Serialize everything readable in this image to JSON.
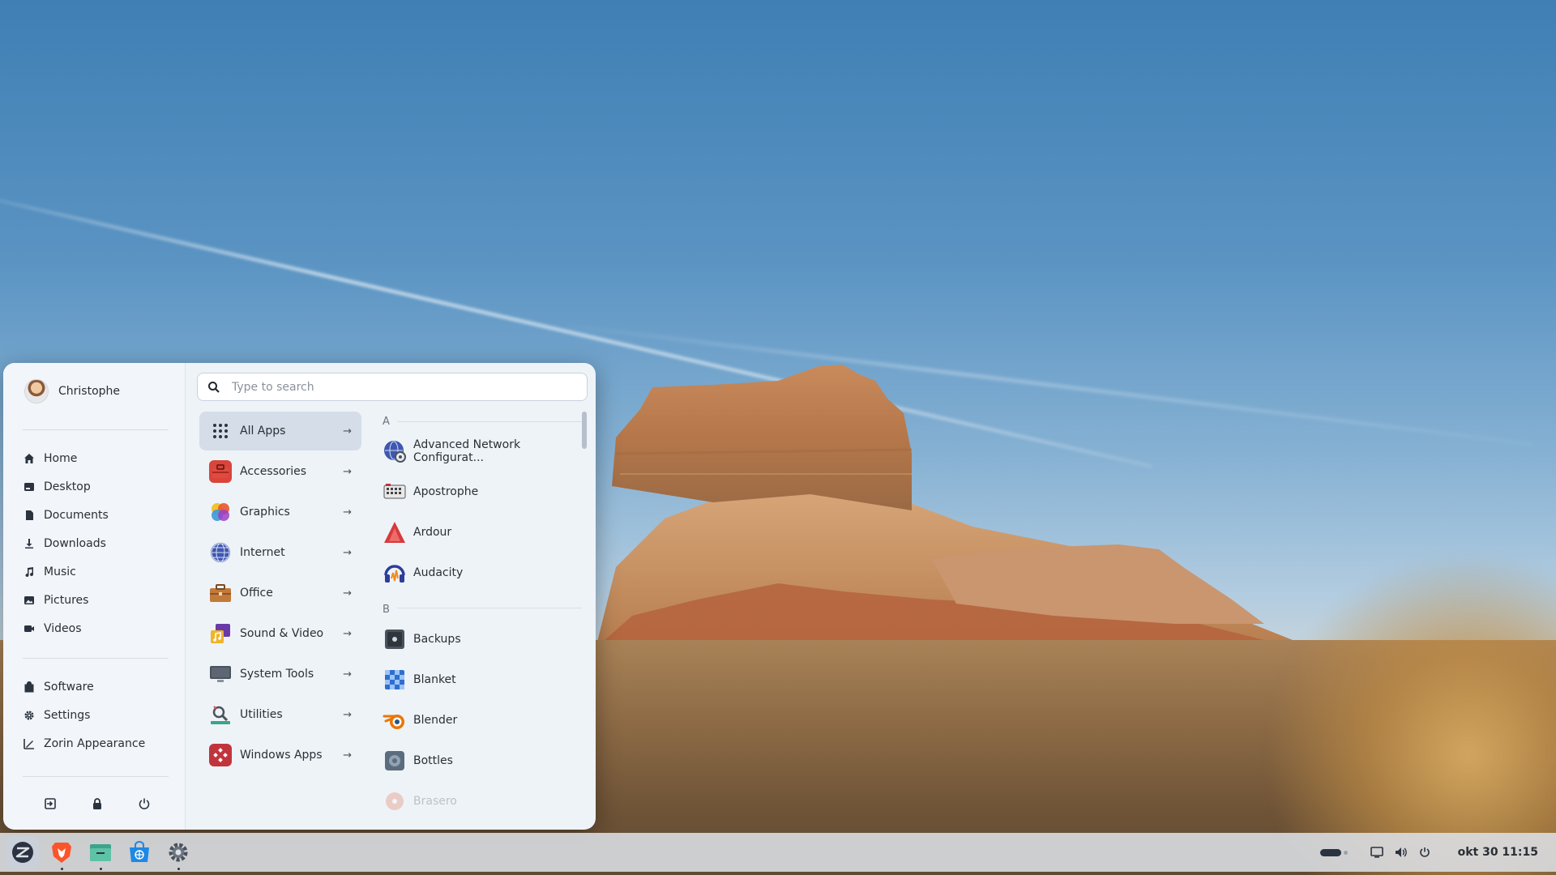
{
  "menu": {
    "user": {
      "name": "Christophe"
    },
    "places": [
      {
        "label": "Home",
        "icon": "home-icon"
      },
      {
        "label": "Desktop",
        "icon": "desktop-icon"
      },
      {
        "label": "Documents",
        "icon": "documents-icon"
      },
      {
        "label": "Downloads",
        "icon": "downloads-icon"
      },
      {
        "label": "Music",
        "icon": "music-icon"
      },
      {
        "label": "Pictures",
        "icon": "pictures-icon"
      },
      {
        "label": "Videos",
        "icon": "videos-icon"
      }
    ],
    "system": [
      {
        "label": "Software",
        "icon": "software-icon"
      },
      {
        "label": "Settings",
        "icon": "gear-icon"
      },
      {
        "label": "Zorin Appearance",
        "icon": "appearance-icon"
      }
    ],
    "search": {
      "placeholder": "Type to search"
    },
    "categories": [
      {
        "label": "All Apps",
        "icon": "grid-icon",
        "active": true
      },
      {
        "label": "Accessories",
        "icon": "toolbox-icon"
      },
      {
        "label": "Graphics",
        "icon": "graphics-icon"
      },
      {
        "label": "Internet",
        "icon": "globe-icon"
      },
      {
        "label": "Office",
        "icon": "briefcase-icon"
      },
      {
        "label": "Sound & Video",
        "icon": "media-icon"
      },
      {
        "label": "System Tools",
        "icon": "monitor-icon"
      },
      {
        "label": "Utilities",
        "icon": "utilities-icon"
      },
      {
        "label": "Windows Apps",
        "icon": "windows-apps-icon"
      }
    ],
    "apps": {
      "letter_a": "A",
      "letter_b": "B",
      "a_items": [
        {
          "label": "Advanced Network Configurat...",
          "icon": "network-config-icon"
        },
        {
          "label": "Apostrophe",
          "icon": "apostrophe-icon"
        },
        {
          "label": "Ardour",
          "icon": "ardour-icon"
        },
        {
          "label": "Audacity",
          "icon": "audacity-icon"
        }
      ],
      "b_items": [
        {
          "label": "Backups",
          "icon": "backups-icon"
        },
        {
          "label": "Blanket",
          "icon": "blanket-icon"
        },
        {
          "label": "Blender",
          "icon": "blender-icon"
        },
        {
          "label": "Bottles",
          "icon": "bottles-icon"
        },
        {
          "label": "Brasero",
          "icon": "brasero-icon"
        }
      ]
    }
  },
  "taskbar": {
    "apps": [
      {
        "name": "zorin-menu",
        "icon": "zorin-logo-icon",
        "active": true
      },
      {
        "name": "brave",
        "icon": "brave-icon",
        "running": true
      },
      {
        "name": "files",
        "icon": "files-icon",
        "running": true
      },
      {
        "name": "software",
        "icon": "software-store-icon"
      },
      {
        "name": "settings",
        "icon": "gear-icon",
        "running": true
      }
    ],
    "clock": "okt 30  11:15"
  },
  "colors": {
    "menu_bg": "#eef3f8",
    "active_category": "#d4dde8",
    "taskbar_bg": "#dce0e6"
  }
}
